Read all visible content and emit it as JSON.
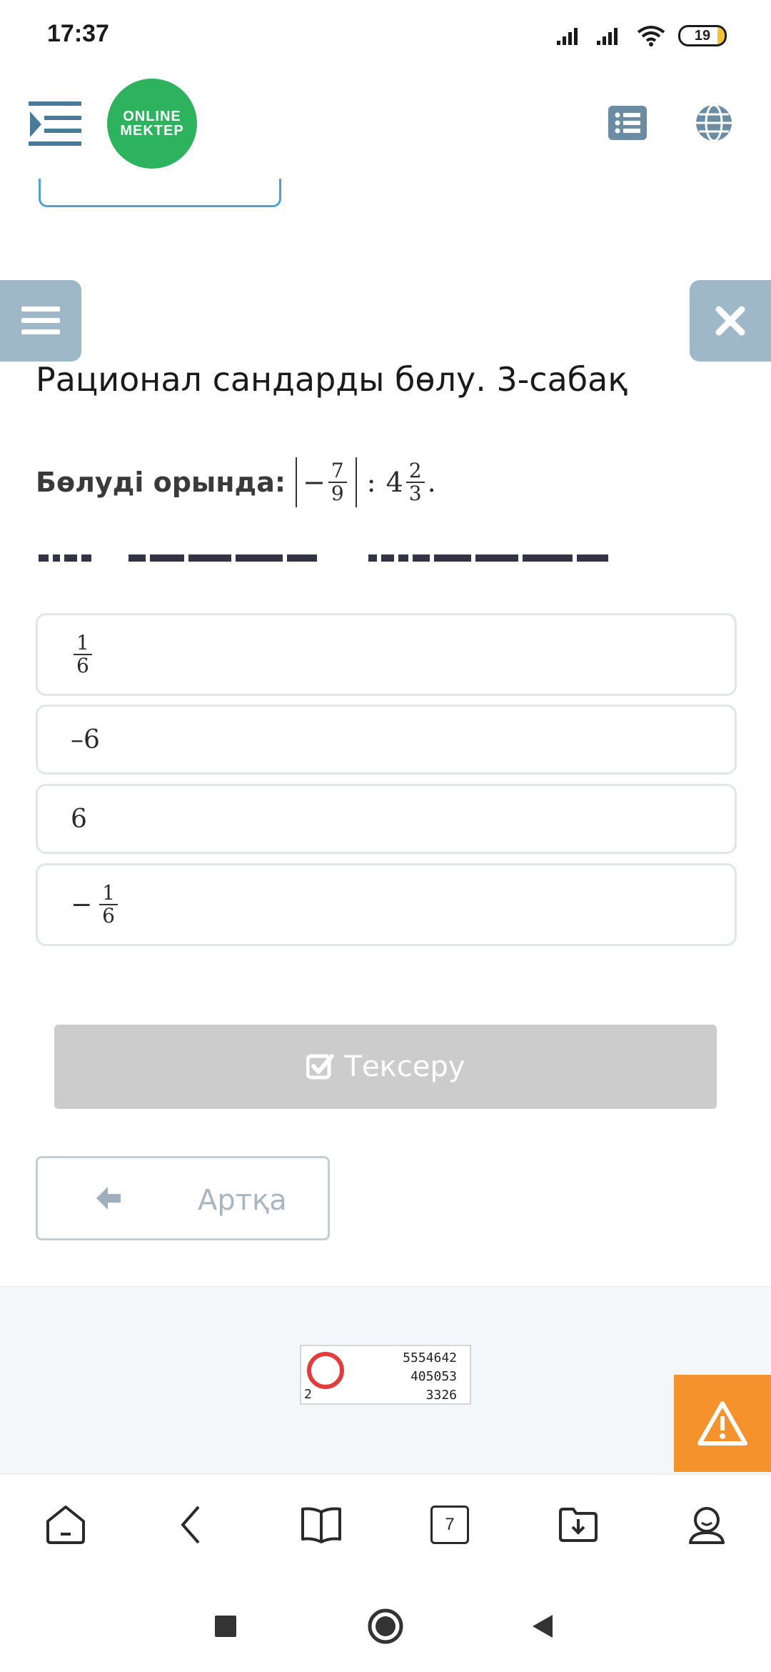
{
  "status_bar": {
    "time": "17:37",
    "battery": "19"
  },
  "header": {
    "logo_line1": "ONLINE",
    "logo_line2": "MEKTEP"
  },
  "lesson": {
    "title": "Рационал сандарды бөлу. 3-сабақ",
    "task_label": "Бөлуді орында:",
    "expression": {
      "abs_sign": "−",
      "abs_num": "7",
      "abs_den": "9",
      "operator": ":",
      "whole": "4",
      "mixed_num": "2",
      "mixed_den": "3",
      "end": "."
    }
  },
  "options": [
    {
      "type": "fraction",
      "sign": "",
      "num": "1",
      "den": "6"
    },
    {
      "type": "text",
      "text": "–6"
    },
    {
      "type": "text",
      "text": "6"
    },
    {
      "type": "fraction",
      "sign": "−",
      "num": "1",
      "den": "6"
    }
  ],
  "buttons": {
    "check_label": "Тексеру",
    "back_label": "Артқа"
  },
  "counter": {
    "line1": "5554642",
    "line2": "405053",
    "line3": "3326",
    "small": "2"
  },
  "bottom_nav": {
    "tabs_count": "7"
  },
  "icons": {
    "menu": "sidebar-toggle-icon",
    "list": "list-icon",
    "globe": "globe-icon",
    "hamburger": "hamburger-icon",
    "close": "close-icon",
    "check": "checkbox-icon",
    "back": "arrow-left-icon",
    "warning": "warning-icon"
  },
  "colors": {
    "brand_green": "#2db35d",
    "side_button": "#9fb8c8",
    "check_button": "#cccccc",
    "warning": "#f5922b",
    "accent_blue": "#4aa3df"
  }
}
